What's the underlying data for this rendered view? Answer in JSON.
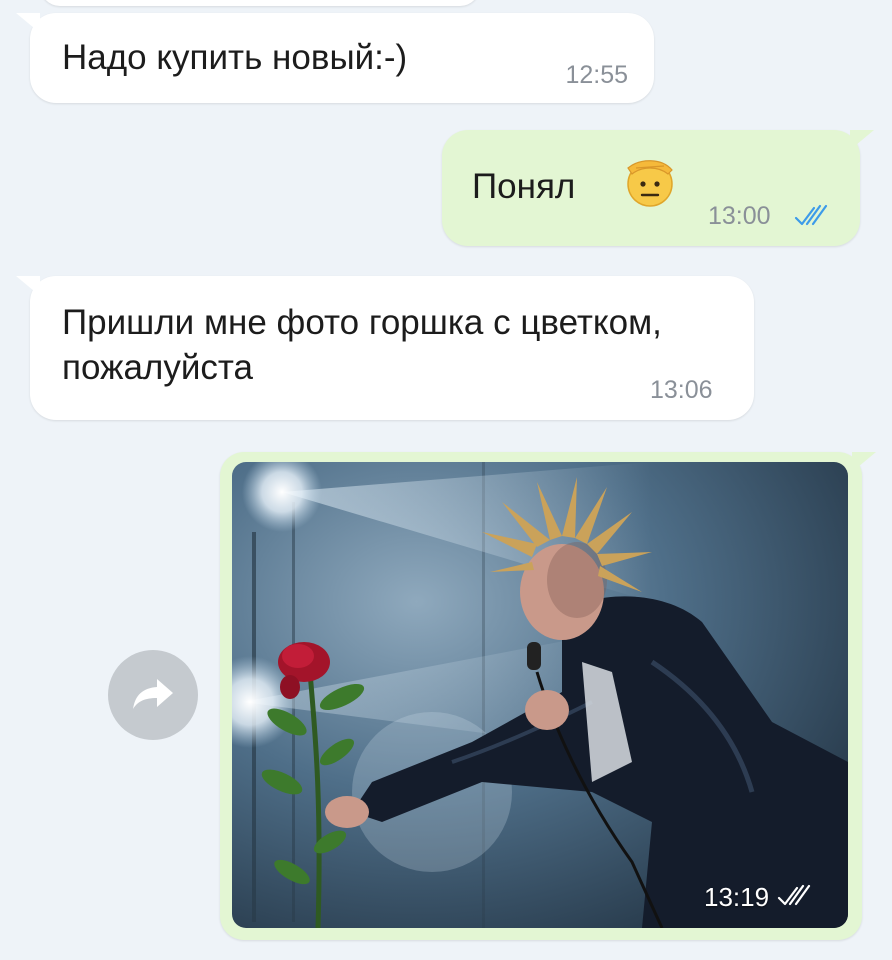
{
  "messages": [
    {
      "direction": "incoming",
      "text": "Надо купить новый:-)",
      "time": "12:55"
    },
    {
      "direction": "outgoing",
      "text": "Понял",
      "emoji": "saluting-face-icon",
      "time": "13:00",
      "status": "read"
    },
    {
      "direction": "incoming",
      "text": "Пришли мне фото горшка с цветком, пожалуйста",
      "time": "13:06"
    },
    {
      "direction": "outgoing",
      "type": "photo",
      "photo_subject": "performer-with-rose",
      "time": "13:19",
      "status": "read"
    }
  ],
  "colors": {
    "background": "#eef3f8",
    "incoming_bubble": "#ffffff",
    "outgoing_bubble": "#e3f6d3",
    "read_check": "#3d9be9",
    "time_text": "#8a9098",
    "forward_button": "#c5cacf"
  },
  "icons": {
    "read_status": "double-check-icon",
    "forward": "forward-arrow-icon",
    "emoji": "saluting-face-icon"
  }
}
